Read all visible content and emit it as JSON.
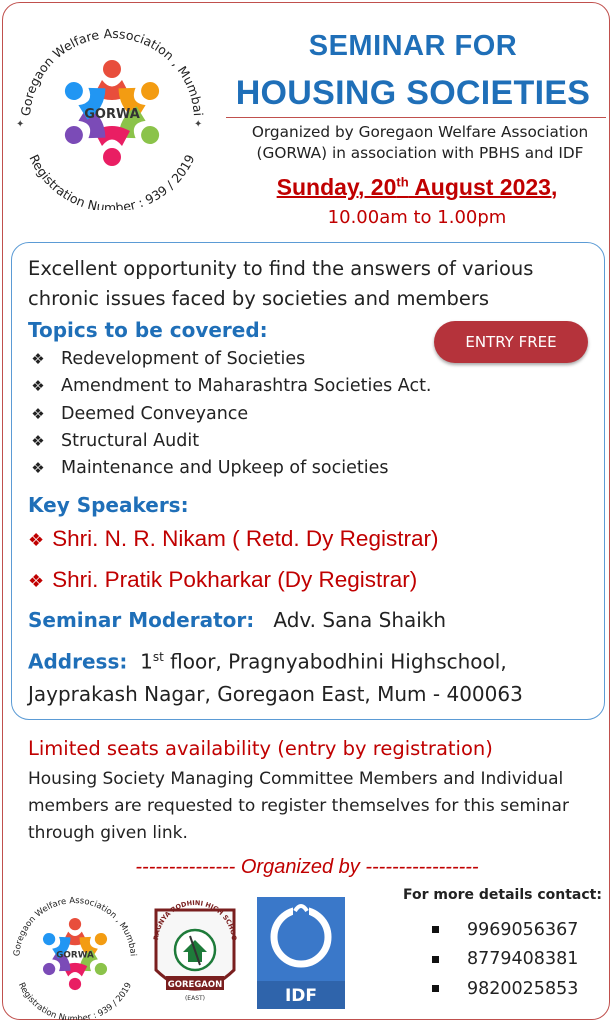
{
  "logo": {
    "org_name": "Goregaon Welfare Association , Mumbai",
    "abbr": "GORWA",
    "registration": "Registration Number : 939 / 2019"
  },
  "header": {
    "title_line1": "SEMINAR FOR",
    "title_line2": "HOUSING SOCIETIES",
    "organizer_line1": "Organized by Goregaon Welfare Association",
    "organizer_line2": "(GORWA) in association with PBHS and IDF",
    "date_prefix": "Sunday, 20",
    "date_sup": "th",
    "date_suffix": " August 2023,",
    "time": "10.00am to 1.00pm"
  },
  "intro": "Excellent opportunity to find the answers of various chronic issues faced by societies and members",
  "topics": {
    "heading": "Topics to be covered:",
    "items": [
      "Redevelopment of Societies",
      "Amendment to Maharashtra Societies Act.",
      "Deemed Conveyance",
      "Structural Audit",
      "Maintenance and Upkeep of societies"
    ]
  },
  "entry_badge": "ENTRY FREE",
  "speakers": {
    "heading": "Key Speakers:",
    "items": [
      "Shri. N. R. Nikam ( Retd. Dy Registrar)",
      "Shri. Pratik Pokharkar (Dy Registrar)"
    ]
  },
  "moderator": {
    "label": "Seminar Moderator:",
    "name": "Adv.  Sana Shaikh"
  },
  "address": {
    "label": "Address:",
    "floor_num": "1",
    "floor_sup": "st",
    "line1_rest": " floor, Pragnyabodhini Highschool,",
    "line2": "Jayprakash Nagar, Goregaon East, Mum - 400063"
  },
  "registration": {
    "limited": "Limited seats availability (entry by registration)",
    "text": "Housing Society Managing Committee Members and Individual members are requested to register themselves for this seminar through given link."
  },
  "organized_by": "--------------- Organized by -----------------",
  "partner_logos": {
    "school_top": "PRAGNYA BODHINI HIGH SCHOOL",
    "school_bottom": "GOREGAON",
    "school_sub": "(EAST)",
    "idf": "IDF"
  },
  "contact": {
    "heading": "For more details contact:",
    "phones": [
      "9969056367",
      "8779408381",
      "9820025853"
    ]
  },
  "colors": {
    "blue": "#1f6fb8",
    "red": "#c00000",
    "badge": "#b5333b",
    "border": "#c0504d",
    "panel_border": "#5b9bd5"
  }
}
